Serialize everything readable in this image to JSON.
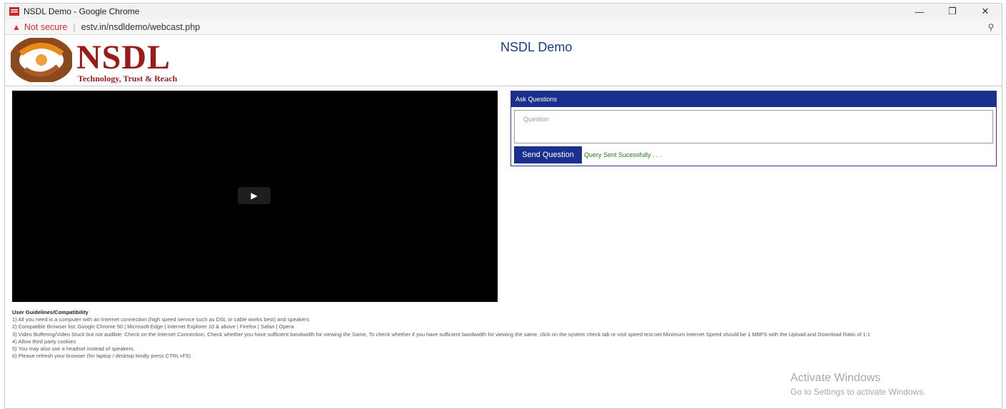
{
  "browser": {
    "window_title": "NSDL Demo - Google Chrome",
    "not_secure": "Not secure",
    "url": "estv.in/nsdldemo/webcast.php",
    "minimize": "—",
    "restore": "❐",
    "close": "✕"
  },
  "header": {
    "logo_word": "NSDL",
    "logo_tagline": "Technology, Trust & Reach",
    "page_title": "NSDL Demo"
  },
  "video": {
    "play_symbol": "▶"
  },
  "questions": {
    "heading": "Ask Questions",
    "placeholder": "Question",
    "send_label": "Send Question",
    "status": "Query Sent Sucessfully . . ."
  },
  "guidelines": {
    "heading": "User Guidelines/Compatibility",
    "items": [
      "1) All you need is a computer with an Internet connection (high speed service such as DSL or cable works best) and speakers",
      "2) Compatible Browser list: Google Chrome 50 | Microsoft Edge | Internet Explorer 10 & above | Firefox | Safari | Opera",
      "3) Video Buffering/Video Stuck but not audible: Check on the Internet Connection, Check whether you have sufficient bandwidth for viewing the Same, To check whether if you have sufficient bandwidth for viewing the same, click on the system check tab or visit speed test.net Minimum Internet Speed should be 1 MBPS with the Upload and Download Ratio of 1:1",
      "4) Allow third party cookies",
      "5) You may also use a headset instead of speakers.",
      "6) Please refresh your browser (for laptop / desktop kindly press CTRL+F5)"
    ]
  },
  "watermark": {
    "line1": "Activate Windows",
    "line2": "Go to Settings to activate Windows."
  }
}
